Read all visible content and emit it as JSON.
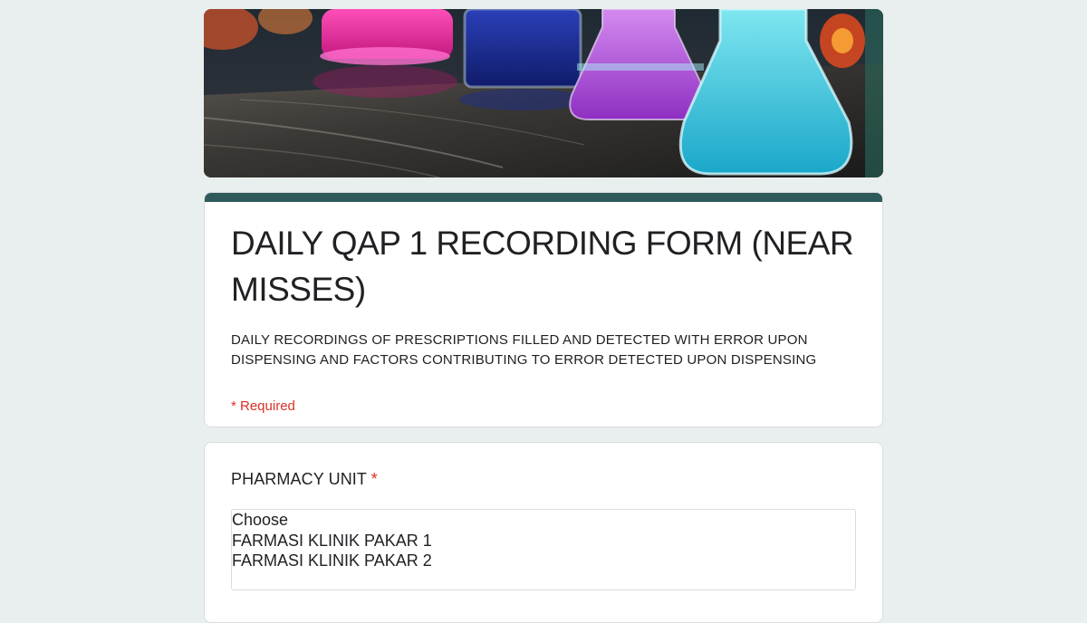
{
  "banner": {
    "icon": "chemistry-flasks-image"
  },
  "form": {
    "title": "DAILY QAP 1 RECORDING FORM (NEAR MISSES)",
    "description_line1": "DAILY RECORDINGS OF PRESCRIPTIONS FILLED AND DETECTED WITH ERROR UPON",
    "description_line2": "DISPENSING AND FACTORS CONTRIBUTING TO ERROR DETECTED UPON DISPENSING",
    "required_note": "* Required",
    "accent_color": "#2e5a5b",
    "required_color": "#d93025"
  },
  "question": {
    "label": "PHARMACY UNIT",
    "required_marker": "*",
    "options": [
      "Choose",
      "FARMASI KLINIK PAKAR 1",
      "FARMASI KLINIK PAKAR 2"
    ]
  }
}
